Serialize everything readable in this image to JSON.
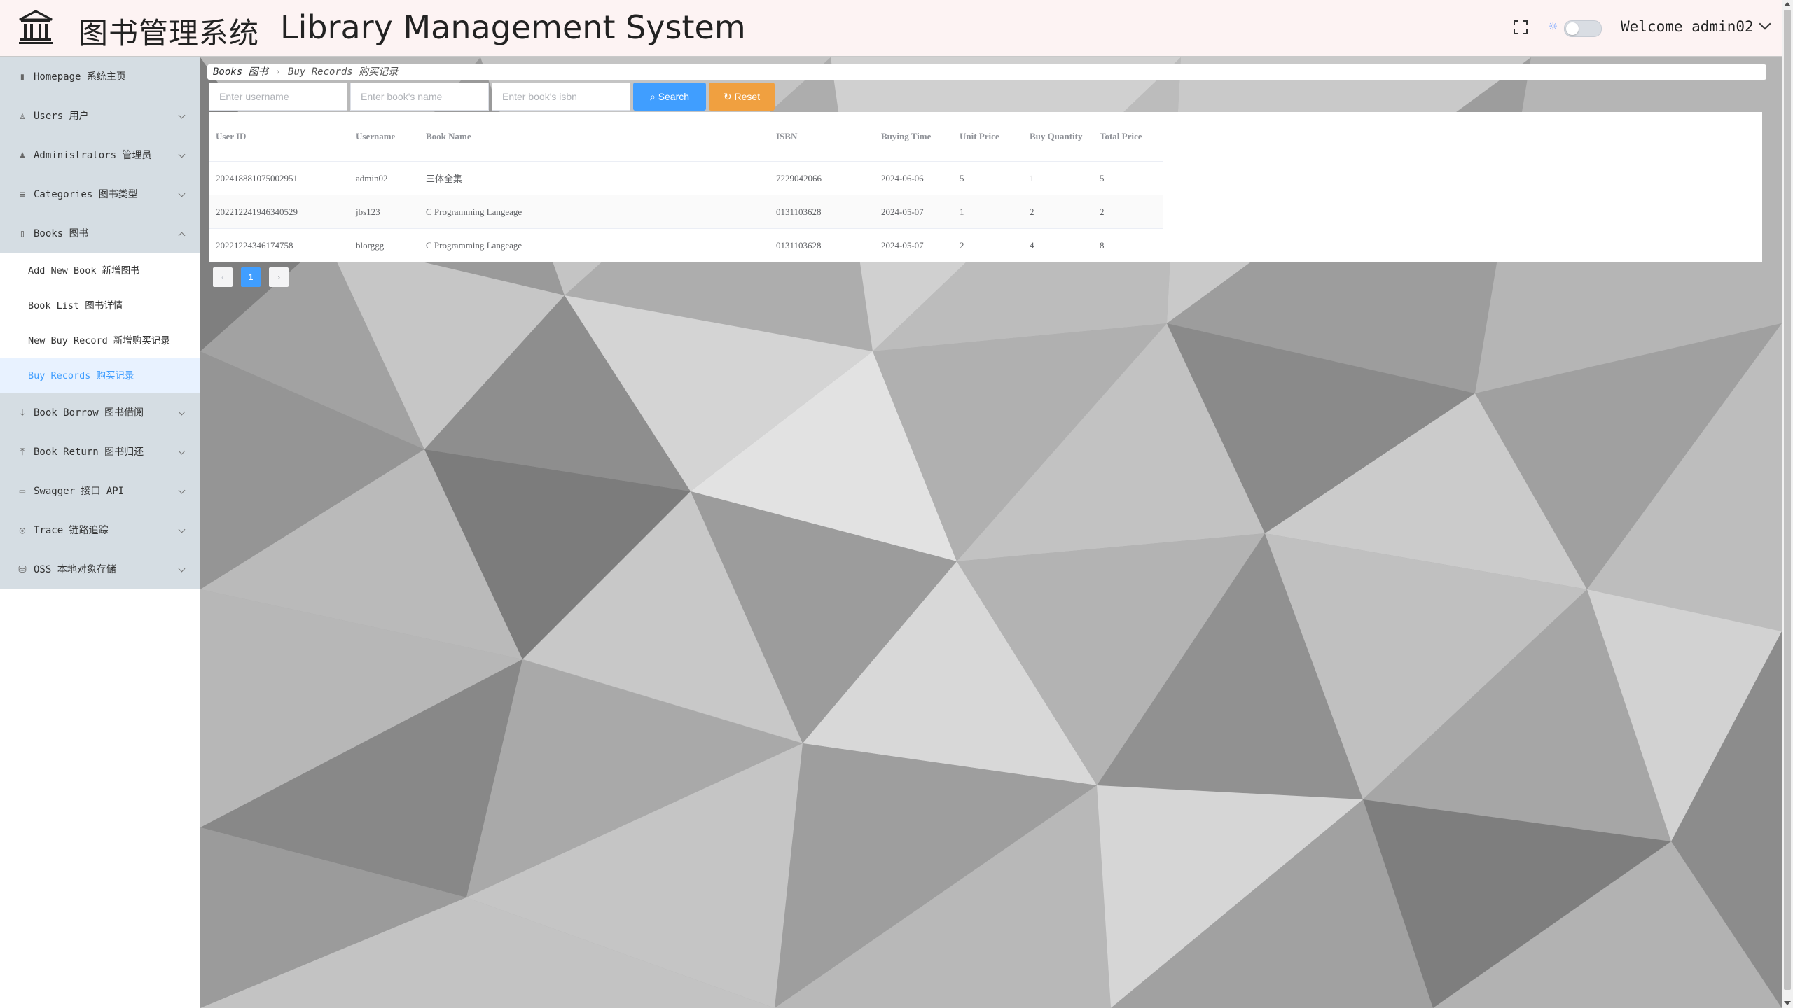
{
  "header": {
    "title_cn": "图书管理系统",
    "title_en": "Library Management System",
    "logo_icon": "library-building-icon",
    "fullscreen_icon": "fullscreen-icon",
    "theme_icon": "sun-icon",
    "welcome": "Welcome admin02"
  },
  "sidebar": {
    "items": [
      {
        "label": "Homepage 系统主页",
        "icon": "bar-chart-icon",
        "glyph": "▮"
      },
      {
        "label": "Users 用户",
        "icon": "user-icon",
        "glyph": "♙"
      },
      {
        "label": "Administrators 管理员",
        "icon": "admin-icon",
        "glyph": "♟"
      },
      {
        "label": "Categories 图书类型",
        "icon": "list-icon",
        "glyph": "≡"
      },
      {
        "label": "Books 图书",
        "icon": "book-icon",
        "glyph": "▯"
      }
    ],
    "books_submenu": [
      {
        "label": "Add New Book 新增图书"
      },
      {
        "label": "Book List 图书详情"
      },
      {
        "label": "New Buy Record 新增购买记录"
      },
      {
        "label": "Buy Records 购买记录"
      }
    ],
    "items_after": [
      {
        "label": "Book Borrow 图书借阅",
        "icon": "download-icon",
        "glyph": "⤓"
      },
      {
        "label": "Book Return 图书归还",
        "icon": "upload-icon",
        "glyph": "⤒"
      },
      {
        "label": "Swagger 接口 API",
        "icon": "folder-icon",
        "glyph": "▭"
      },
      {
        "label": "Trace 链路追踪",
        "icon": "target-icon",
        "glyph": "◎"
      },
      {
        "label": "OSS 本地对象存储",
        "icon": "database-icon",
        "glyph": "⛁"
      }
    ]
  },
  "breadcrumb": {
    "parent": "Books 图书",
    "current": "Buy Records 购买记录"
  },
  "search": {
    "username_placeholder": "Enter username",
    "bookname_placeholder": "Enter book's name",
    "isbn_placeholder": "Enter book's isbn",
    "search_label": "Search",
    "reset_label": "Reset"
  },
  "table": {
    "headers": [
      "User ID",
      "Username",
      "Book Name",
      "ISBN",
      "Buying Time",
      "Unit Price",
      "Buy Quantity",
      "Total Price"
    ],
    "rows": [
      [
        "202418881075002951",
        "admin02",
        "三体全集",
        "7229042066",
        "2024-06-06",
        "5",
        "1",
        "5"
      ],
      [
        "202212241946340529",
        "jbs123",
        "C Programming Langeage",
        "0131103628",
        "2024-05-07",
        "1",
        "2",
        "2"
      ],
      [
        "20221224346174758",
        "blorggg",
        "C Programming Langeage",
        "0131103628",
        "2024-05-07",
        "2",
        "4",
        "8"
      ]
    ]
  },
  "pagination": {
    "current": "1",
    "prev_icon": "chevron-left-icon",
    "next_icon": "chevron-right-icon"
  }
}
